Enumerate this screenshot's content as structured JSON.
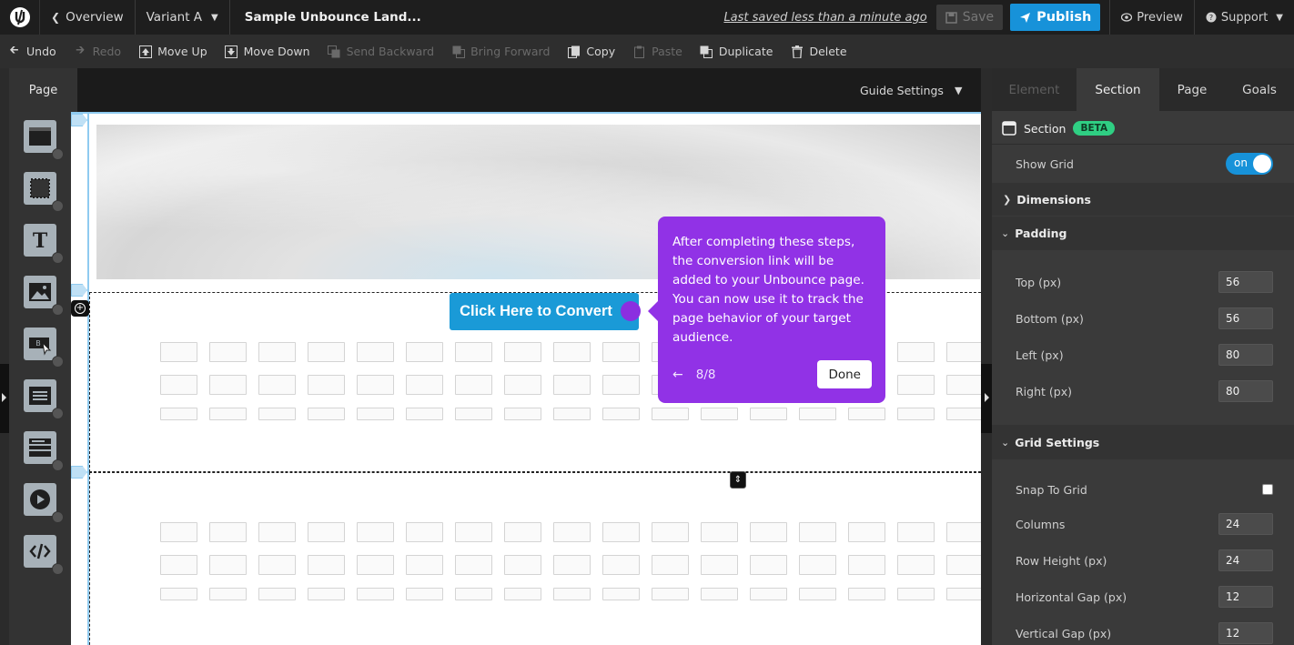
{
  "topbar": {
    "overview_label": "Overview",
    "variant_label": "Variant A",
    "page_name": "Sample Unbounce Land...",
    "last_saved": "Last saved  less than a minute ago",
    "save_label": "Save",
    "publish_label": "Publish",
    "preview_label": "Preview",
    "support_label": "Support"
  },
  "toolbar": {
    "undo": "Undo",
    "redo": "Redo",
    "move_up": "Move Up",
    "move_down": "Move Down",
    "send_backward": "Send Backward",
    "bring_forward": "Bring Forward",
    "copy": "Copy",
    "paste": "Paste",
    "duplicate": "Duplicate",
    "delete": "Delete"
  },
  "canvas_header": {
    "page_tab": "Page",
    "guide_settings": "Guide Settings"
  },
  "widgets": [
    "section-icon",
    "box-icon",
    "text-icon",
    "image-icon",
    "button-icon",
    "form-icon",
    "list-icon",
    "video-icon",
    "code-icon"
  ],
  "canvas": {
    "cta_label": "Click Here to Convert"
  },
  "tour": {
    "text": "After completing these steps, the conversion link will be added to your Unbounce page. You can now use it to track the page behavior of your target audience.",
    "back": "←",
    "step": "8/8",
    "done": "Done"
  },
  "panel": {
    "tabs": {
      "element": "Element",
      "section": "Section",
      "page": "Page",
      "goals": "Goals"
    },
    "section_title": "Section",
    "beta": "BETA",
    "show_grid": {
      "label": "Show Grid",
      "value": "on"
    },
    "dimensions": "Dimensions",
    "padding": {
      "title": "Padding",
      "top_label": "Top (px)",
      "top": "56",
      "bottom_label": "Bottom (px)",
      "bottom": "56",
      "left_label": "Left (px)",
      "left": "80",
      "right_label": "Right (px)",
      "right": "80"
    },
    "grid_settings": {
      "title": "Grid Settings",
      "snap_label": "Snap To Grid",
      "columns_label": "Columns",
      "columns": "24",
      "row_height_label": "Row Height (px)",
      "row_height": "24",
      "hgap_label": "Horizontal Gap (px)",
      "hgap": "12",
      "vgap_label": "Vertical Gap (px)",
      "vgap": "12"
    }
  },
  "colors": {
    "accent_blue": "#1792d9",
    "tour_purple": "#9132e6",
    "beta_green": "#2fcf83"
  }
}
